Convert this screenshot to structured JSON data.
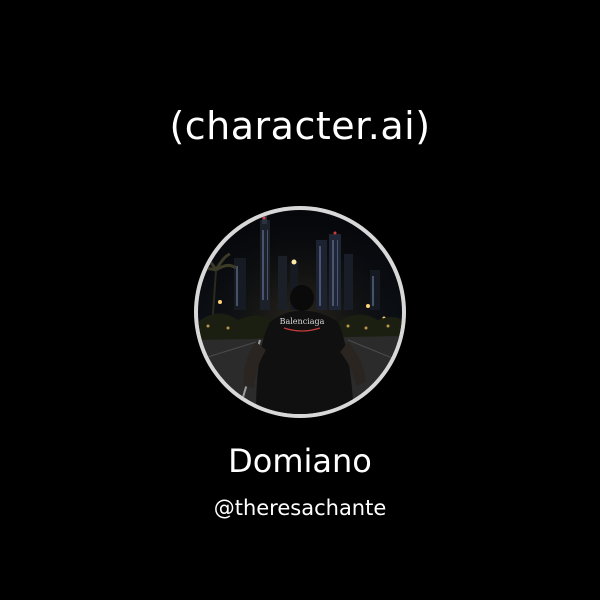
{
  "brand": {
    "logo_text": "(character.ai)"
  },
  "profile": {
    "name": "Domiano",
    "handle": "@theresachante",
    "avatar_icon": "profile-photo-night-city"
  },
  "colors": {
    "background": "#000000",
    "text": "#ffffff",
    "avatar_ring": "#d8d8d8"
  }
}
